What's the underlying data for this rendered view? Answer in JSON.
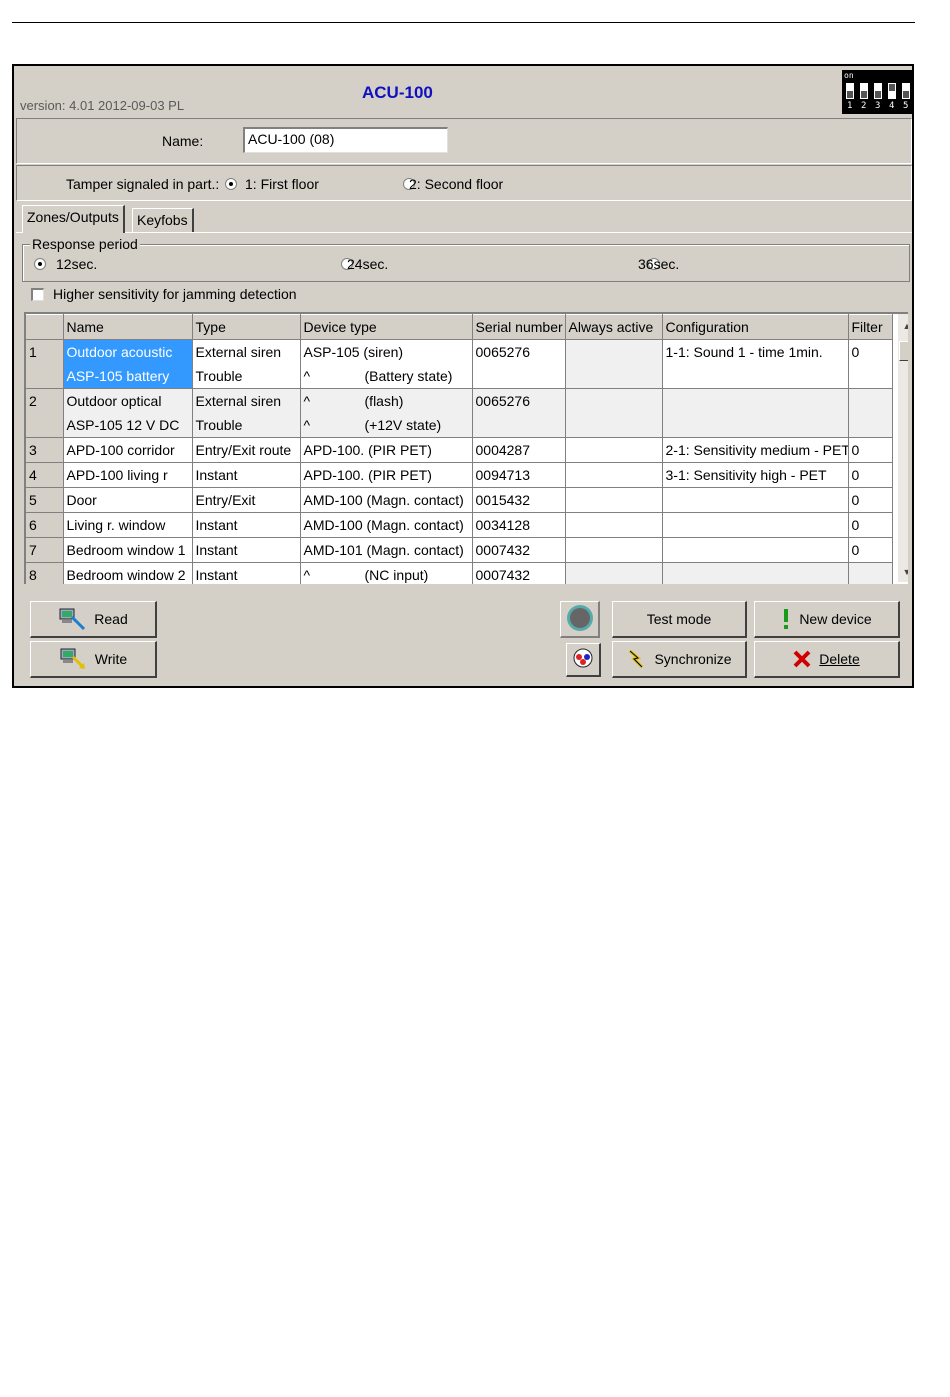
{
  "window": {
    "title": "ACU-100",
    "version": "version: 4.01 2012-09-03 PL",
    "dip_switch": {
      "on_label": "on",
      "numbers": [
        "1",
        "2",
        "3",
        "4",
        "5"
      ]
    }
  },
  "name_field": {
    "label": "Name:",
    "value": "ACU-100     (08)"
  },
  "tamper": {
    "label": "Tamper signaled in part.:",
    "options": [
      {
        "label": "1: First floor",
        "selected": true
      },
      {
        "label": "2: Second floor",
        "selected": false
      }
    ]
  },
  "tabs": [
    {
      "label": "Zones/Outputs",
      "active": true
    },
    {
      "label": "Keyfobs",
      "active": false
    }
  ],
  "response_period": {
    "legend": "Response period",
    "options": [
      {
        "label": "12sec.",
        "selected": true
      },
      {
        "label": "24sec.",
        "selected": false
      },
      {
        "label": "36sec.",
        "selected": false
      }
    ]
  },
  "jamming": {
    "label": "Higher sensitivity for jamming detection",
    "checked": false
  },
  "table": {
    "columns": [
      "",
      "Name",
      "Type",
      "Device type",
      "Serial number",
      "Always active",
      "Configuration",
      "Filter"
    ],
    "rows": [
      {
        "num": "1",
        "name": [
          "Outdoor acoustic",
          "ASP-105 battery"
        ],
        "type": [
          "External siren",
          "Trouble"
        ],
        "device": [
          "ASP-105 (siren)",
          "^              (Battery state)"
        ],
        "serial": [
          "0065276",
          ""
        ],
        "always": "",
        "config": [
          "1-1: Sound 1 - time 1min.",
          ""
        ],
        "filter": [
          "0",
          ""
        ]
      },
      {
        "num": "2",
        "name": [
          "Outdoor optical",
          "ASP-105 12 V DC"
        ],
        "type": [
          "External siren",
          "Trouble"
        ],
        "device": [
          "^              (flash)",
          "^              (+12V state)"
        ],
        "serial": [
          "0065276",
          ""
        ],
        "always": "",
        "config": [
          "",
          ""
        ],
        "filter": [
          "",
          ""
        ]
      },
      {
        "num": "3",
        "name": [
          "APD-100 corridor"
        ],
        "type": [
          "Entry/Exit route"
        ],
        "device": [
          "APD-100. (PIR PET)"
        ],
        "serial": [
          "0004287"
        ],
        "always": "",
        "config": [
          "2-1: Sensitivity medium - PET"
        ],
        "filter": [
          "0"
        ]
      },
      {
        "num": "4",
        "name": [
          "APD-100 living r"
        ],
        "type": [
          "Instant"
        ],
        "device": [
          "APD-100. (PIR PET)"
        ],
        "serial": [
          "0094713"
        ],
        "always": "",
        "config": [
          "3-1: Sensitivity high - PET"
        ],
        "filter": [
          "0"
        ]
      },
      {
        "num": "5",
        "name": [
          "Door"
        ],
        "type": [
          "Entry/Exit"
        ],
        "device": [
          "AMD-100 (Magn. contact)"
        ],
        "serial": [
          "0015432"
        ],
        "always": "",
        "config": [
          ""
        ],
        "filter": [
          "0"
        ]
      },
      {
        "num": "6",
        "name": [
          "Living r. window"
        ],
        "type": [
          "Instant"
        ],
        "device": [
          "AMD-100 (Magn. contact)"
        ],
        "serial": [
          "0034128"
        ],
        "always": "",
        "config": [
          ""
        ],
        "filter": [
          "0"
        ]
      },
      {
        "num": "7",
        "name": [
          "Bedroom window 1"
        ],
        "type": [
          "Instant"
        ],
        "device": [
          "AMD-101 (Magn. contact)"
        ],
        "serial": [
          "0007432"
        ],
        "always": "",
        "config": [
          ""
        ],
        "filter": [
          "0"
        ]
      },
      {
        "num": "8",
        "name": [
          "Bedroom window 2"
        ],
        "type": [
          "Instant"
        ],
        "device": [
          "^              (NC input)"
        ],
        "serial": [
          "0007432"
        ],
        "always": "",
        "config": [
          ""
        ],
        "filter": [
          ""
        ]
      }
    ]
  },
  "buttons": {
    "read": "Read",
    "write": "Write",
    "test_mode": "Test mode",
    "synchronize": "Synchronize",
    "new_device": "New device",
    "delete": "Delete"
  },
  "colors": {
    "title": "#1010c0",
    "selection": "#3399ff",
    "window_bg": "#d4d0c8",
    "delete_icon": "#d00000",
    "new_device_icon": "#1a9a1a"
  }
}
